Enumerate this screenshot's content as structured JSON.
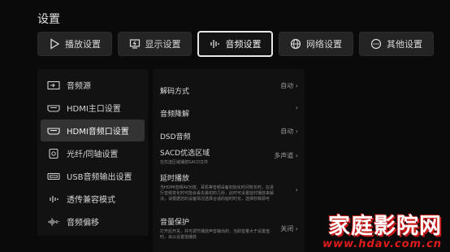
{
  "page_title": "设置",
  "tabs": [
    {
      "label": "播放设置",
      "icon": "play-icon"
    },
    {
      "label": "显示设置",
      "icon": "display-icon"
    },
    {
      "label": "音频设置",
      "icon": "audio-wave-icon",
      "active": true
    },
    {
      "label": "网络设置",
      "icon": "globe-icon"
    },
    {
      "label": "其他设置",
      "icon": "more-icon"
    }
  ],
  "sidebar": {
    "items": [
      {
        "label": "音频源",
        "icon": "audio-source-icon"
      },
      {
        "label": "HDMI主口设置",
        "icon": "hdmi-icon"
      },
      {
        "label": "HDMI音频口设置",
        "icon": "hdmi-icon",
        "selected": true
      },
      {
        "label": "光纤/同轴设置",
        "icon": "optical-coax-icon"
      },
      {
        "label": "USB音频输出设置",
        "icon": "usb-icon"
      },
      {
        "label": "透传兼容模式",
        "icon": "passthrough-icon"
      },
      {
        "label": "音频偏移",
        "icon": "audio-offset-icon"
      }
    ]
  },
  "settings": [
    {
      "label": "解码方式",
      "value": "自动 ›",
      "sub": ""
    },
    {
      "label": "音频降解",
      "value": "›",
      "sub": ""
    },
    {
      "label": "DSD音频",
      "value": "自动 ›",
      "sub": ""
    },
    {
      "label": "SACD优选区域",
      "value": "多声道 ›",
      "sub": "在优选区域播放SACD文件"
    },
    {
      "label": "延时播放",
      "value": "›",
      "sub": "当HDMI音频AV功放、耳机等音频设备初始化时间较长时，在进行音频变化时可能会丢失最初的几秒，此时可设置延时播放来解决，请根据您的设备情况选择合适的延时时长，选择秒数即可"
    },
    {
      "label": "音量保护",
      "value": "关闭 ›",
      "sub": "打开后开关，并可调节播放声音输出的，当耐音量大于设置值时，会以设置值播放"
    }
  ],
  "watermark": {
    "main": "家庭影院网",
    "sub": "www.hdav.com.cn"
  }
}
